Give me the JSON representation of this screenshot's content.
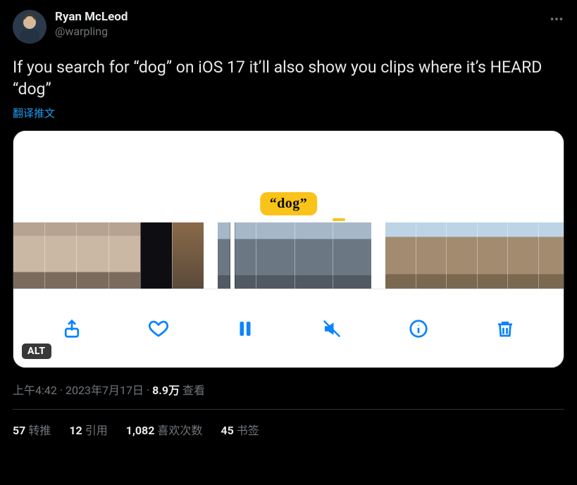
{
  "author": {
    "display_name": "Ryan McLeod",
    "handle": "@warpling"
  },
  "tweet_text": "If you search for “dog” on iOS 17 it’ll also show you clips where it’s HEARD “dog”",
  "translate_label": "翻译推文",
  "caption_text": "“dog”",
  "alt_label": "ALT",
  "meta": {
    "time": "上午4:42",
    "sep": " · ",
    "date": "2023年7月17日",
    "views_number": "8.9万",
    "views_label": " 查看"
  },
  "stats": {
    "retweets_num": "57",
    "retweets_label": "转推",
    "quotes_num": "12",
    "quotes_label": "引用",
    "likes_num": "1,082",
    "likes_label": "喜欢次数",
    "bookmarks_num": "45",
    "bookmarks_label": "书签"
  },
  "toolbar_icons": {
    "share": "share-icon",
    "heart": "heart-icon",
    "pause": "pause-icon",
    "mute": "mute-icon",
    "info": "info-icon",
    "trash": "trash-icon"
  }
}
